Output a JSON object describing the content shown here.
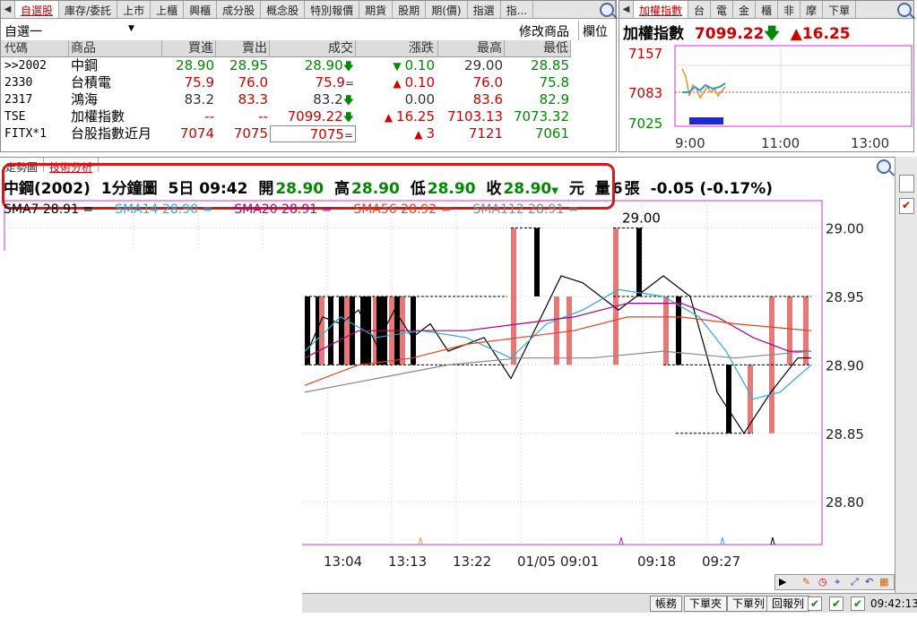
{
  "quote_panel": {
    "tabs": [
      "自選股",
      "庫存/委託",
      "上市",
      "上櫃",
      "興櫃",
      "成分股",
      "概念股",
      "特別報價",
      "期貨",
      "股期",
      "期(價)",
      "指選",
      "指..."
    ],
    "active_tab": 0,
    "group_selector": "自選一",
    "edit_label": "修改商品",
    "columns_label": "欄位",
    "headers": [
      "代碼",
      "商品",
      "買進",
      "賣出",
      "成交",
      "漲跌",
      "最高",
      "最低"
    ],
    "rows": [
      {
        "code": ">>2002",
        "name": "中鋼",
        "bid": "28.90",
        "ask": "28.95",
        "last": "28.90",
        "last_mark": "down",
        "chg": "0.10",
        "chg_mark": "down",
        "high": "29.00",
        "low": "28.85",
        "color": "green",
        "high_color": "black"
      },
      {
        "code": "2330",
        "name": "台積電",
        "bid": "75.9",
        "ask": "76.0",
        "last": "75.9",
        "last_mark": "flat",
        "chg": "0.10",
        "chg_mark": "up",
        "high": "76.0",
        "low": "75.8",
        "color": "red",
        "high_color": "red"
      },
      {
        "code": "2317",
        "name": "鴻海",
        "bid": "83.2",
        "ask": "83.3",
        "last": "83.2",
        "last_mark": "down",
        "chg": "0.00",
        "chg_mark": "none",
        "high": "83.6",
        "low": "82.9",
        "color": "black",
        "high_color": "red"
      },
      {
        "code": "TSE",
        "name": "加權指數",
        "bid": "--",
        "ask": "--",
        "last": "7099.22",
        "last_mark": "down",
        "chg": "16.25",
        "chg_mark": "up",
        "high": "7103.13",
        "low": "7073.32",
        "color": "red",
        "high_color": "red"
      },
      {
        "code": "FITX*1",
        "name": "台股指數近月",
        "bid": "7074",
        "ask": "7075",
        "last": "7075",
        "last_mark": "flat",
        "chg": "3",
        "chg_mark": "up",
        "high": "7121",
        "low": "7061",
        "color": "red",
        "high_color": "red"
      }
    ]
  },
  "index_panel": {
    "tabs": [
      "加權指數",
      "台",
      "電",
      "金",
      "櫃",
      "非",
      "摩",
      "下單"
    ],
    "active_tab": 0,
    "title": "加權指數",
    "value": "7099.22",
    "change": "16.25",
    "yticks": [
      "7157",
      "7083",
      "7025"
    ],
    "xticks": [
      "9:00",
      "11:00",
      "13:00"
    ]
  },
  "chart_panel": {
    "tabs": [
      "走勢圖",
      "技術分析"
    ],
    "active_tab": 1,
    "info": {
      "symbol": "中鋼(2002)",
      "period": "1分鐘圖",
      "date_time": "5日 09:42",
      "open_label": "開",
      "open": "28.90",
      "high_label": "高",
      "high": "28.90",
      "low_label": "低",
      "low": "28.90",
      "close_label": "收",
      "close": "28.90",
      "unit": "元",
      "volume_label": "量",
      "volume": "6",
      "volume_unit": "張",
      "change": "-0.05 (-0.17%)"
    },
    "sma": [
      {
        "label": "SMA7 28.91 =",
        "color": "#000000"
      },
      {
        "label": "SMA14 28.90 =",
        "color": "#33aacc"
      },
      {
        "label": "SMA20 28.91 =",
        "color": "#aa0077"
      },
      {
        "label": "SMA56 28.92 =",
        "color": "#dd4422"
      },
      {
        "label": "SMA112 28.91 =",
        "color": "#888888"
      }
    ],
    "peak_label": "29.00"
  },
  "chart_data": {
    "type": "bar",
    "yticks": [
      29.0,
      28.95,
      28.9,
      28.85,
      28.8
    ],
    "ylim": [
      28.77,
      29.02
    ],
    "xticks": [
      "13:04",
      "13:13",
      "13:22",
      "01/05 09:01",
      "09:18",
      "09:27"
    ],
    "visible_bars": [
      {
        "open": 28.95,
        "close": 28.9
      },
      {
        "open": 28.95,
        "close": 28.9
      },
      {
        "open": 28.9,
        "close": 28.95
      },
      {
        "open": 28.95,
        "close": 28.9
      },
      {
        "open": 28.95,
        "close": 28.9
      },
      {
        "open": 28.9,
        "close": 28.95
      },
      {
        "open": 28.95,
        "close": 28.9
      },
      {
        "open": 28.95,
        "close": 28.9
      },
      {
        "open": 28.95,
        "close": 28.9
      },
      {
        "open": 28.9,
        "close": 28.95
      },
      {
        "open": 28.95,
        "close": 28.9
      },
      {
        "open": 28.95,
        "close": 28.9
      },
      {
        "open": 28.9,
        "close": 28.95
      },
      {
        "open": 28.95,
        "close": 28.9
      },
      {
        "open": 28.9,
        "close": 28.95
      },
      {
        "open": 28.95,
        "close": 28.9
      },
      {
        "open": 28.9,
        "close": 29.0
      },
      {
        "open": 29.0,
        "close": 28.95
      },
      {
        "open": 28.9,
        "close": 28.95
      },
      {
        "open": 28.9,
        "close": 28.95
      },
      {
        "open": 28.9,
        "close": 29.0
      },
      {
        "open": 29.0,
        "close": 28.95
      },
      {
        "open": 28.9,
        "close": 28.95
      },
      {
        "open": 28.95,
        "close": 28.9
      },
      {
        "open": 28.9,
        "close": 28.85
      },
      {
        "open": 28.85,
        "close": 28.9
      },
      {
        "open": 28.85,
        "close": 28.95
      },
      {
        "open": 28.9,
        "close": 28.95
      },
      {
        "open": 28.9,
        "close": 28.95
      }
    ]
  },
  "status_bar": {
    "buttons": [
      "帳務",
      "下單夾",
      "下單列",
      "回報列"
    ],
    "clock": "09:42:13"
  },
  "colors": {
    "up": "#cc0000",
    "down": "#008800",
    "bar_up": "#e87878",
    "bar_down": "#000000",
    "frame": "#cc33cc"
  }
}
